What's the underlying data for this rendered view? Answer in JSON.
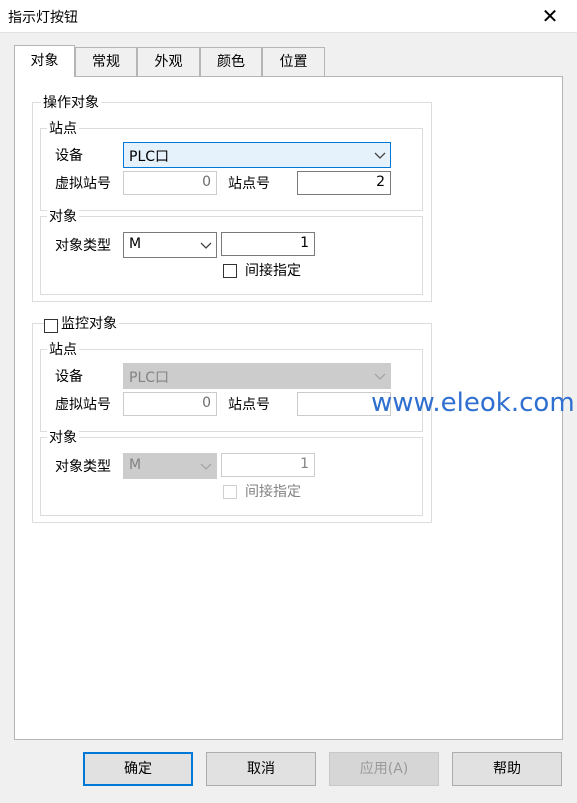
{
  "window": {
    "title": "指示灯按钮",
    "close_glyph": "✕"
  },
  "tabs": [
    {
      "label": "对象"
    },
    {
      "label": "常规"
    },
    {
      "label": "外观"
    },
    {
      "label": "颜色"
    },
    {
      "label": "位置"
    }
  ],
  "operation": {
    "title": "操作对象",
    "station_group": "站点",
    "device_label": "设备",
    "device_value": "PLC口",
    "virtual_station_label": "虚拟站号",
    "virtual_station_value": "0",
    "station_no_label": "站点号",
    "station_no_value": "2",
    "object_group": "对象",
    "object_type_label": "对象类型",
    "object_type_value": "M",
    "address_value": "1",
    "indirect_label": "间接指定"
  },
  "monitor": {
    "title": "监控对象",
    "station_group": "站点",
    "device_label": "设备",
    "device_value": "PLC口",
    "virtual_station_label": "虚拟站号",
    "virtual_station_value": "0",
    "station_no_label": "站点号",
    "object_group": "对象",
    "object_type_label": "对象类型",
    "object_type_value": "M",
    "address_value": "1",
    "indirect_label": "间接指定"
  },
  "watermark": "www.eleok.com",
  "buttons": {
    "ok": "确定",
    "cancel": "取消",
    "apply": "应用(A)",
    "help": "帮助"
  }
}
